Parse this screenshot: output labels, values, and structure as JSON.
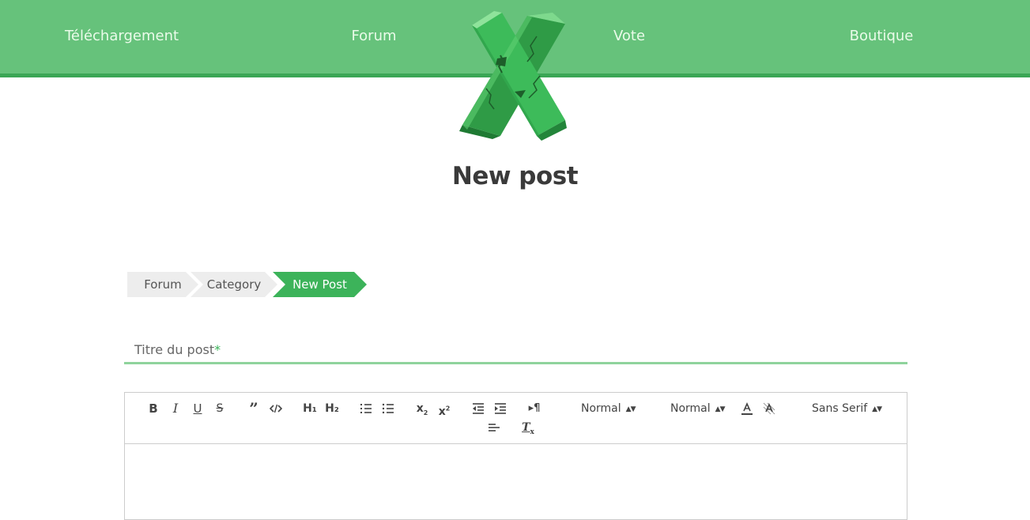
{
  "nav": {
    "items": [
      {
        "label": "Téléchargement"
      },
      {
        "label": "Forum"
      },
      {
        "label": "Vote"
      },
      {
        "label": "Boutique"
      }
    ]
  },
  "colors": {
    "topbar": "#66c27b",
    "topbar_border": "#3aa655",
    "accent": "#3cb35a",
    "input_underline": "#8fd39c"
  },
  "page": {
    "title": "New post"
  },
  "breadcrumb": {
    "items": [
      {
        "label": "Forum"
      },
      {
        "label": "Category"
      },
      {
        "label": "New Post"
      }
    ]
  },
  "form": {
    "title_label": "Titre du post",
    "title_required_mark": "*"
  },
  "editor": {
    "toolbar": {
      "header_h1": "H₁",
      "header_h2": "H₂",
      "size_picker": "Normal",
      "header_picker": "Normal",
      "font_picker": "Sans Serif"
    }
  }
}
